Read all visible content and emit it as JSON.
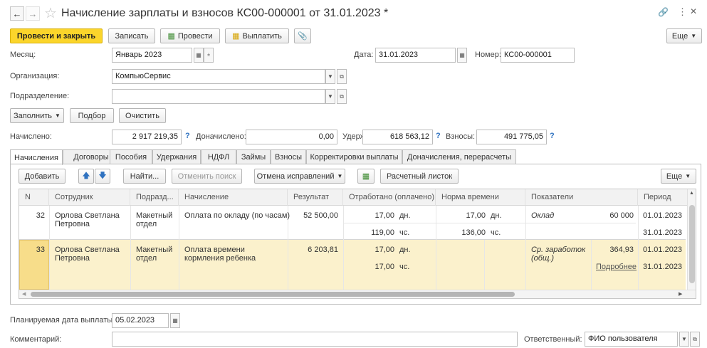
{
  "title": "Начисление зарплаты и взносов КС00-000001 от 31.01.2023 *",
  "toolbar": {
    "post_close": "Провести и закрыть",
    "save": "Записать",
    "post": "Провести",
    "pay": "Выплатить",
    "more": "Еще"
  },
  "form": {
    "month_label": "Месяц:",
    "month_value": "Январь 2023",
    "date_label": "Дата:",
    "date_value": "31.01.2023",
    "number_label": "Номер:",
    "number_value": "КС00-000001",
    "org_label": "Организация:",
    "org_value": "КомпьюСервис",
    "dept_label": "Подразделение:",
    "dept_value": ""
  },
  "actions": {
    "fill": "Заполнить",
    "pick": "Подбор",
    "clear": "Очистить"
  },
  "totals": {
    "accrued_label": "Начислено:",
    "accrued_value": "2 917 219,35",
    "additional_label": "Доначислено:",
    "additional_value": "0,00",
    "withheld_label": "Удержано:",
    "withheld_value": "618 563,12",
    "contrib_label": "Взносы:",
    "contrib_value": "491 775,05",
    "help": "?"
  },
  "tabs": [
    "Начисления",
    "Договоры",
    "Пособия",
    "Удержания",
    "НДФЛ",
    "Займы",
    "Взносы",
    "Корректировки выплаты",
    "Доначисления, перерасчеты"
  ],
  "grid_toolbar": {
    "add": "Добавить",
    "find": "Найти...",
    "cancel_search": "Отменить поиск",
    "cancel_fixes": "Отмена исправлений",
    "payslip": "Расчетный листок",
    "more": "Еще"
  },
  "columns": [
    "N",
    "Сотрудник",
    "Подразд...",
    "Начисление",
    "Результат",
    "Отработано (оплачено)",
    "Норма времени",
    "Показатели",
    "Период"
  ],
  "rows": [
    {
      "n": "32",
      "employee": "Орлова Светлана Петровна",
      "dept": "Макетный отдел",
      "accrual": "Оплата по окладу (по часам)",
      "result": "52 500,00",
      "worked_days": "17,00",
      "worked_days_unit": "дн.",
      "worked_hours": "119,00",
      "worked_hours_unit": "чс.",
      "norm_days": "17,00",
      "norm_days_unit": "дн.",
      "norm_hours": "136,00",
      "norm_hours_unit": "чс.",
      "indicator": "Оклад",
      "indicator_value": "60 000",
      "period_start": "01.01.2023",
      "period_end": "31.01.2023"
    },
    {
      "n": "33",
      "employee": "Орлова Светлана Петровна",
      "dept": "Макетный отдел",
      "accrual": "Оплата времени кормления ребенка",
      "result": "6 203,81",
      "worked_days": "17,00",
      "worked_days_unit": "дн.",
      "worked_hours": "17,00",
      "worked_hours_unit": "чс.",
      "indicator": "Ср. заработок (общ.)",
      "indicator_value": "364,93",
      "details_link": "Подробнее",
      "period_start": "01.01.2023",
      "period_end": "31.01.2023"
    }
  ],
  "footer": {
    "pay_date_label": "Планируемая дата выплаты:",
    "pay_date_value": "05.02.2023",
    "comment_label": "Комментарий:",
    "comment_value": "",
    "responsible_label": "Ответственный:",
    "responsible_value": "ФИО пользователя"
  },
  "colors": {
    "accent": "#fbd52b",
    "selected_row": "#fbf1cc",
    "help": "#2f72c0"
  }
}
